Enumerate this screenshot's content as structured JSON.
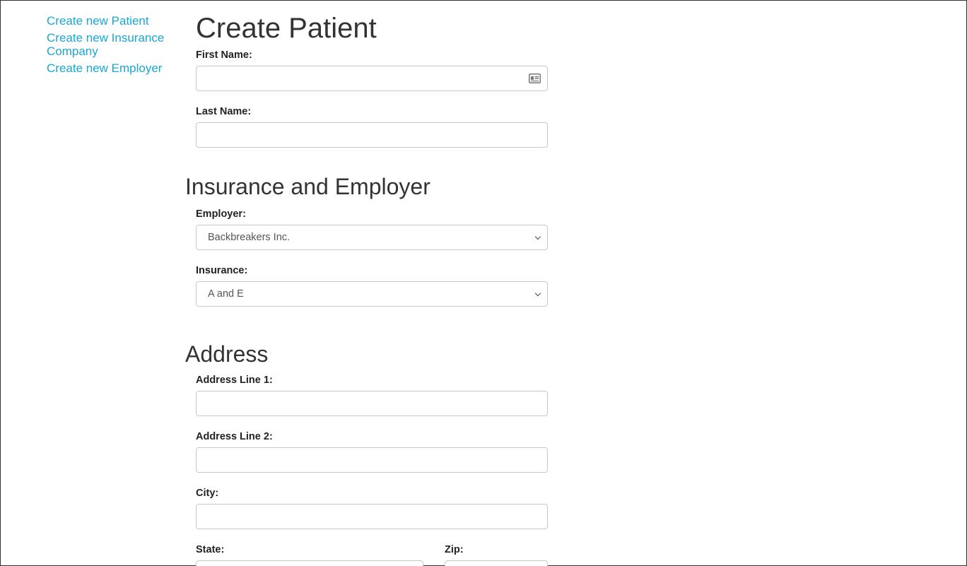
{
  "sidebar": {
    "links": [
      {
        "label": "Create new Patient"
      },
      {
        "label": "Create new Insurance Company"
      },
      {
        "label": "Create new Employer"
      }
    ]
  },
  "page": {
    "title": "Create Patient"
  },
  "patient": {
    "first_name_label": "First Name:",
    "first_name_value": "",
    "last_name_label": "Last Name:",
    "last_name_value": ""
  },
  "insurance_section": {
    "heading": "Insurance and Employer",
    "employer_label": "Employer:",
    "employer_selected": "Backbreakers Inc.",
    "insurance_label": "Insurance:",
    "insurance_selected": "A and E"
  },
  "address_section": {
    "heading": "Address",
    "line1_label": "Address Line 1:",
    "line2_label": "Address Line 2:",
    "city_label": "City:",
    "state_label": "State:",
    "zip_label": "Zip:"
  },
  "colors": {
    "link": "#1aa7d4",
    "input_border": "#c8c8c8",
    "heading": "#333333"
  },
  "icons": {
    "first_name_field_icon": "contact-card-icon"
  }
}
